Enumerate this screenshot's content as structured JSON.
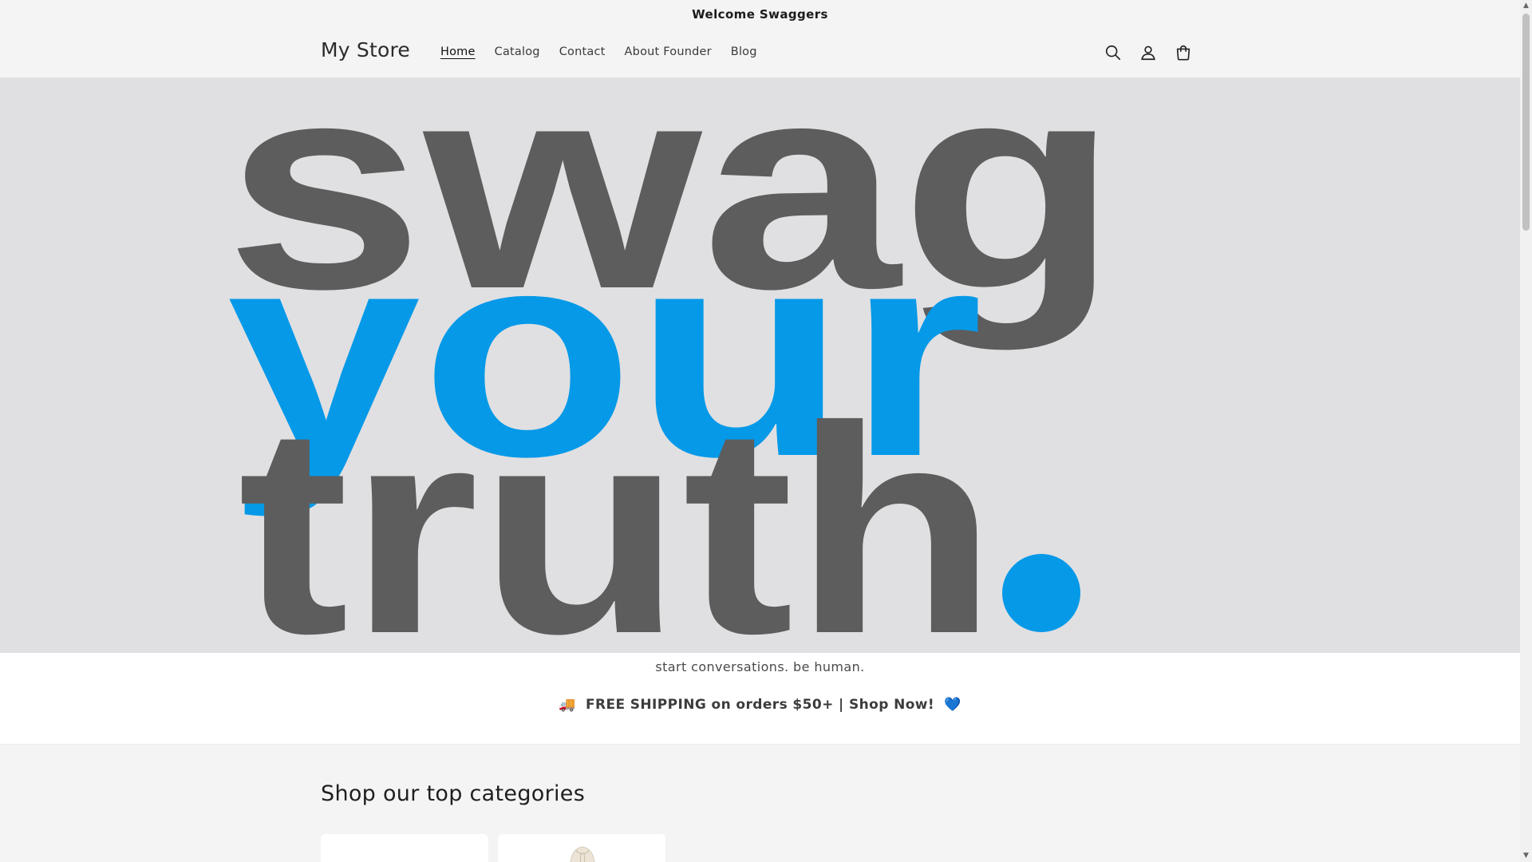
{
  "announcement": "Welcome Swaggers",
  "header": {
    "logo": "My Store",
    "nav": [
      {
        "label": "Home",
        "active": true
      },
      {
        "label": "Catalog",
        "active": false
      },
      {
        "label": "Contact",
        "active": false
      },
      {
        "label": "About Founder",
        "active": false
      },
      {
        "label": "Blog",
        "active": false
      }
    ],
    "icons": [
      "search-icon",
      "account-icon",
      "cart-icon"
    ]
  },
  "hero": {
    "words": [
      "swag",
      "your",
      "truth",
      "."
    ],
    "colors": {
      "gray": "#5d5d5d",
      "blue": "#0699e8",
      "background": "#e0e0e2"
    }
  },
  "tagline": "start conversations. be human.",
  "shipping": {
    "emoji_left": "🚚",
    "text": "FREE SHIPPING on orders $50+ | Shop Now!",
    "emoji_right": "💙"
  },
  "categories": {
    "title": "Shop our top categories"
  }
}
